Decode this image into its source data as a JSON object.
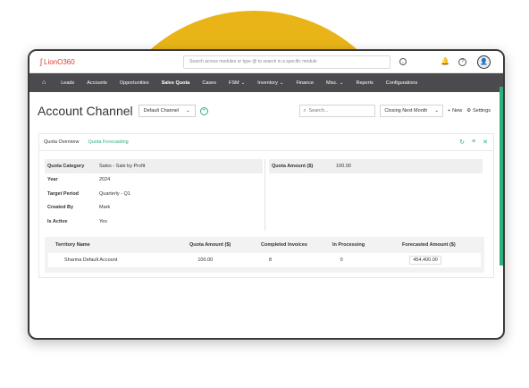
{
  "brand": {
    "logo_text": "LionO360",
    "logo_mark": "ʃ",
    "accent": "#2db079",
    "ring_color": "#e9b418",
    "nav_bg": "#4a4a4f"
  },
  "topbar": {
    "search_placeholder": "Search across modules or type @ to search in a specific module"
  },
  "nav": {
    "items": [
      {
        "label": "Leads",
        "dropdown": false
      },
      {
        "label": "Accounts",
        "dropdown": false
      },
      {
        "label": "Opportunities",
        "dropdown": false
      },
      {
        "label": "Sales Quota",
        "dropdown": false,
        "active": true
      },
      {
        "label": "Cases",
        "dropdown": false
      },
      {
        "label": "FSM",
        "dropdown": true
      },
      {
        "label": "Inventory",
        "dropdown": true
      },
      {
        "label": "Finance",
        "dropdown": false
      },
      {
        "label": "Misc.",
        "dropdown": true
      },
      {
        "label": "Reports",
        "dropdown": false
      },
      {
        "label": "Configurations",
        "dropdown": false
      }
    ]
  },
  "header": {
    "title": "Account Channel",
    "view_select": "Default Channel",
    "search_placeholder": "Search...",
    "filter_select": "Closing Next Month",
    "new_label": "New",
    "settings_label": "Settings"
  },
  "tabs": [
    {
      "label": "Quota Overview",
      "active": false
    },
    {
      "label": "Quota Forecasting",
      "active": true
    }
  ],
  "details_left": [
    {
      "label": "Quota Category",
      "value": "Sales - Sale by Profit"
    },
    {
      "label": "Year",
      "value": "2024"
    },
    {
      "label": "Target Period",
      "value": "Quarterly - Q1"
    },
    {
      "label": "Created By",
      "value": "Mark"
    },
    {
      "label": "Is Active",
      "value": "Yes"
    }
  ],
  "details_right": [
    {
      "label": "Quota Amount ($)",
      "value": "100.00"
    }
  ],
  "table": {
    "headers": [
      "Territory Name",
      "Quota Amount ($)",
      "Completed Invoices",
      "In Processing",
      "Forecasted Amount ($)"
    ],
    "rows": [
      [
        "Sharma Default Account",
        "100.00",
        "8",
        "0",
        "454,400.00"
      ]
    ]
  }
}
